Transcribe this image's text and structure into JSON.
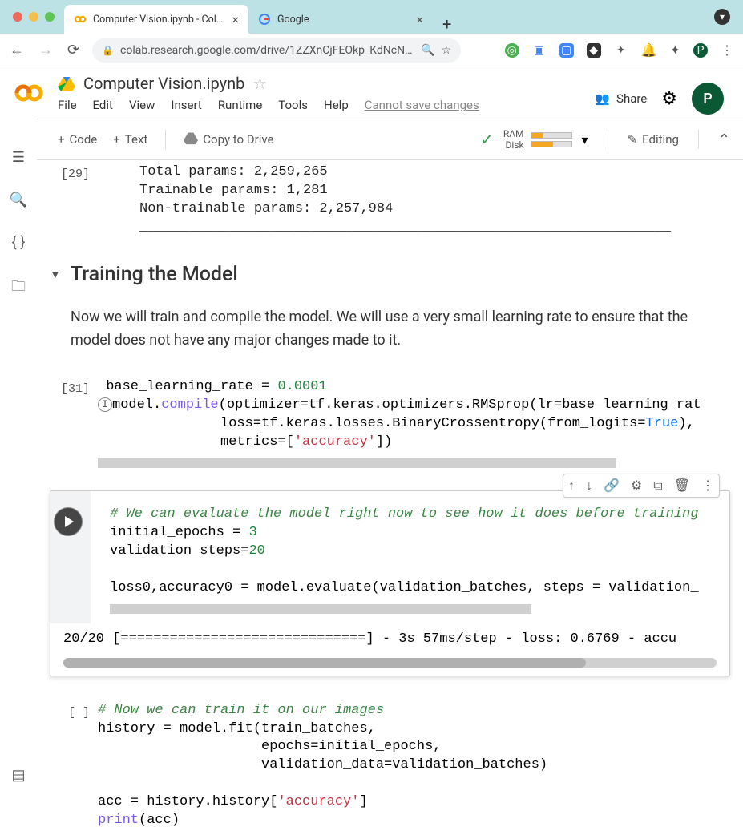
{
  "browser": {
    "tabs": [
      {
        "title": "Computer Vision.ipynb - Colab",
        "active": true,
        "icon": "colab"
      },
      {
        "title": "Google",
        "active": false,
        "icon": "google"
      }
    ],
    "url": "colab.research.google.com/drive/1ZZXnCjFEOkp_KdNcNabd1…",
    "profile_letter": "P",
    "prof_dot": "▾"
  },
  "colab": {
    "title": "Computer Vision.ipynb",
    "menus": [
      "File",
      "Edit",
      "View",
      "Insert",
      "Runtime",
      "Tools",
      "Help"
    ],
    "readonly_msg": "Cannot save changes",
    "share": "Share",
    "avatar": "P"
  },
  "toolbar": {
    "code": "Code",
    "text": "Text",
    "copy_drive": "Copy to Drive",
    "ram_label": "RAM",
    "disk_label": "Disk",
    "ram_pct": 30,
    "disk_pct": 55,
    "editing": "Editing"
  },
  "output_prev": {
    "cell_num": "[29]",
    "lines": [
      "Total params: 2,259,265",
      "Trainable params: 1,281",
      "Non-trainable params: 2,257,984",
      "_________________________________________________________________"
    ]
  },
  "section": {
    "title": "Training the Model",
    "body": "Now we will train and compile the model. We will use a very small learning rate to ensure that the model does not have any major changes made to it."
  },
  "cell31": {
    "num": "[31]",
    "lr_val": "0.0001",
    "true_kw": "True",
    "accuracy": "'accuracy'"
  },
  "cell_active": {
    "comment": "# We can evaluate the model right now to see how it does before training",
    "epochs": "3",
    "vsteps": "20",
    "output": "20/20 [==============================] - 3s 57ms/step - loss: 0.6769 - accu"
  },
  "cell_empty": {
    "num": "[ ]",
    "comment": "# Now we can train it on our images",
    "accuracy": "'accuracy'"
  }
}
